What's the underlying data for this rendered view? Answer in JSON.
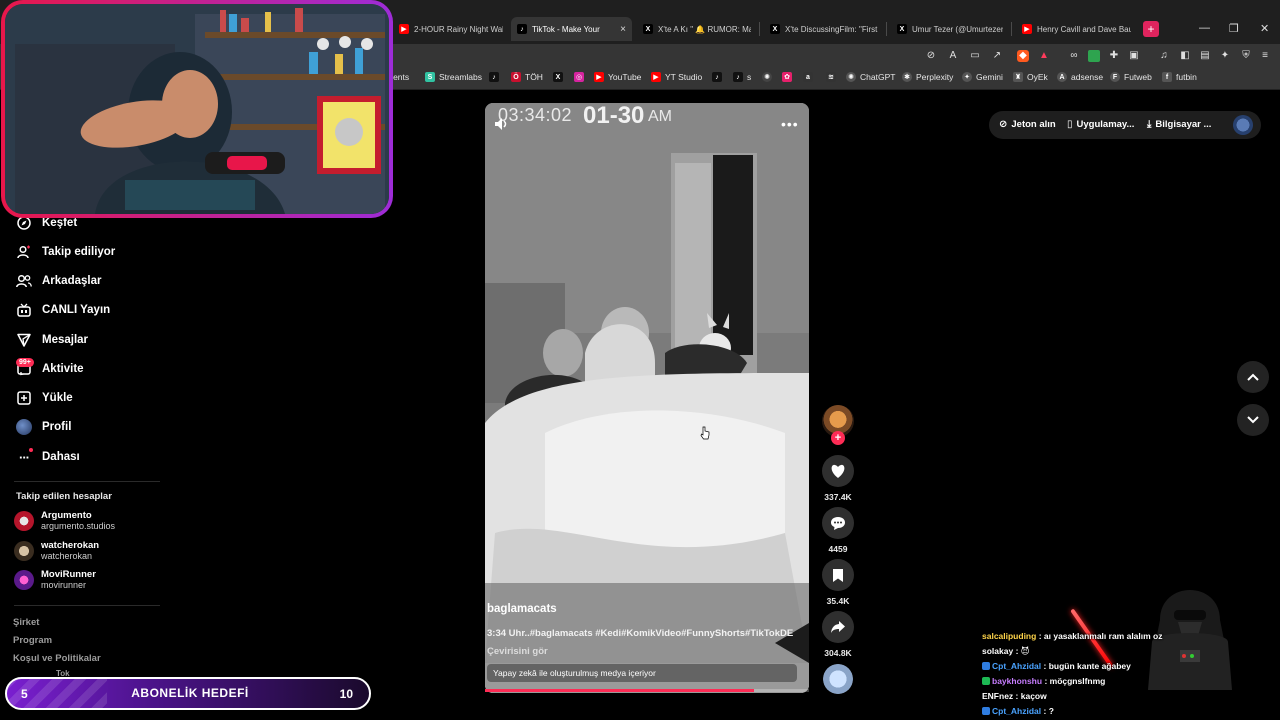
{
  "browser": {
    "tabs": [
      {
        "label": "2-HOUR Rainy Night Walk",
        "favicon": "youtube",
        "color": "#ff0000",
        "active": false
      },
      {
        "label": "TikTok - Make Your",
        "favicon": "tiktok",
        "color": "#000000",
        "active": true
      },
      {
        "label": "X'te A Kı \" 🔔 RUMOR: Ma",
        "favicon": "x",
        "color": "#000000",
        "active": false
      },
      {
        "label": "X'te DiscussingFilm: \"First",
        "favicon": "x",
        "color": "#000000",
        "active": false
      },
      {
        "label": "Umur Tezer (@Umurtezer)",
        "favicon": "x",
        "color": "#000000",
        "active": false
      },
      {
        "label": "Henry Cavill and Dave Bau",
        "favicon": "youtube",
        "color": "#ff0000",
        "active": false
      }
    ],
    "new_tab": "+",
    "bookmarks": [
      {
        "label": "ments",
        "icon": ""
      },
      {
        "label": "Streamlabs",
        "icon": "streamlabs",
        "color": "#31c3a2"
      },
      {
        "label": "",
        "icon": "tiktok",
        "color": "#111111"
      },
      {
        "label": "TÖH",
        "icon": "toh",
        "color": "#c8102e"
      },
      {
        "label": "",
        "icon": "x",
        "color": "#111111"
      },
      {
        "label": "",
        "icon": "instagram",
        "color": "#d6249f"
      },
      {
        "label": "YouTube",
        "icon": "youtube",
        "color": "#ff0000"
      },
      {
        "label": "YT Studio",
        "icon": "yt-studio",
        "color": "#ff0000"
      },
      {
        "label": "",
        "icon": "tiktok",
        "color": "#111111"
      },
      {
        "label": "s",
        "icon": "tiktok",
        "color": "#111111"
      },
      {
        "label": "",
        "icon": "openai",
        "color": "#444444"
      },
      {
        "label": "",
        "icon": "app",
        "color": "#e6206b"
      },
      {
        "label": "",
        "icon": "amazon",
        "color": "#333333"
      },
      {
        "label": "",
        "icon": "zx",
        "color": "#333333"
      },
      {
        "label": "ChatGPT",
        "icon": "chatgpt",
        "color": "#555555"
      },
      {
        "label": "Perplexity",
        "icon": "perplexity",
        "color": "#555555"
      },
      {
        "label": "Gemini",
        "icon": "gemini",
        "color": "#555555"
      },
      {
        "label": "OyEk",
        "icon": "oyek",
        "color": "#555555"
      },
      {
        "label": "adsense",
        "icon": "adsense",
        "color": "#555555"
      },
      {
        "label": "Futweb",
        "icon": "futweb",
        "color": "#555555"
      },
      {
        "label": "futbin",
        "icon": "futbin",
        "color": "#555555"
      }
    ]
  },
  "sidebar": {
    "nav": [
      {
        "label": "Keşfet",
        "icon": "compass-icon"
      },
      {
        "label": "Takip ediliyor",
        "icon": "following-icon"
      },
      {
        "label": "Arkadaşlar",
        "icon": "friends-icon"
      },
      {
        "label": "CANLI Yayın",
        "icon": "live-icon"
      },
      {
        "label": "Mesajlar",
        "icon": "messages-icon"
      },
      {
        "label": "Aktivite",
        "icon": "activity-icon"
      },
      {
        "label": "Yükle",
        "icon": "upload-icon"
      },
      {
        "label": "Profil",
        "icon": "profile-icon"
      },
      {
        "label": "Dahası",
        "icon": "more-icon"
      }
    ],
    "activity_badge": "99+",
    "followed_title": "Takip edilen hesaplar",
    "followed": [
      {
        "name": "Argumento",
        "handle": "argumento.studios"
      },
      {
        "name": "watcherokan",
        "handle": "watcherokan"
      },
      {
        "name": "MoviRunner",
        "handle": "movirunner"
      }
    ],
    "footer": [
      "Şirket",
      "Program",
      "Koşul ve Politikalar"
    ],
    "footer_partial": "Tok"
  },
  "video": {
    "timestamp": "03:34:02",
    "timestamp_overlay": "01-30",
    "am": "AM",
    "username": "baglamacats",
    "description": "3:34 Uhr..#baglamacats #Kedi#KomikVideo#FunnyShorts#TikTokDE",
    "translate": "Çevirisini gör",
    "ai_label": "Yapay zekâ ile oluşturulmuş medya içeriyor",
    "progress": 0.83
  },
  "actions": {
    "likes": "337.4K",
    "comments": "4459",
    "saves": "35.4K",
    "shares": "304.8K"
  },
  "topbar": {
    "coins": "Jeton alın",
    "app": "Uygulamay...",
    "computer": "Bilgisayar ..."
  },
  "chat": [
    {
      "user": "salcalipuding",
      "color": "#ffd54a",
      "msg": ": aı yasaklanmalı ram alalım oz"
    },
    {
      "user": "solakay",
      "color": "#ffffff",
      "msg": ": 😈"
    },
    {
      "user": "Cpt_Ahzidal",
      "color": "#4aa3ff",
      "msg": ": bugün kante ağabey"
    },
    {
      "user": "baykhonshu",
      "color": "#c77dff",
      "msg": ": möçgnslfnmg"
    },
    {
      "user": "ENFnez",
      "color": "#ffffff",
      "msg": ": kaçow"
    },
    {
      "user": "Cpt_Ahzidal",
      "color": "#4aa3ff",
      "msg": ": ?"
    }
  ],
  "goal": {
    "title": "ABONELİK HEDEFİ",
    "current": "5",
    "target": "10"
  }
}
